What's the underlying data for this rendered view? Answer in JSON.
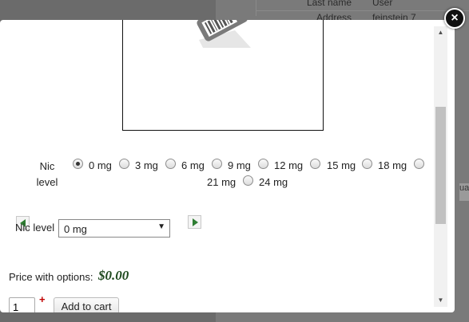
{
  "background": {
    "rows": [
      {
        "key": "Last name",
        "value": "User"
      },
      {
        "key": "Address",
        "value": "feinstein 7"
      }
    ],
    "edge_text": "ua"
  },
  "modal": {
    "close_glyph": "×",
    "product_image_icon": "barcode-price-tag-icon",
    "nic_level": {
      "label_line1": "Nic",
      "label_line2": "level",
      "options": [
        "0 mg",
        "3 mg",
        "6 mg",
        "9 mg",
        "12 mg",
        "15 mg",
        "18 mg",
        "21 mg",
        "24 mg"
      ],
      "selected": "0 mg"
    },
    "nic_level_select": {
      "label": "Nic level",
      "value": "0 mg"
    },
    "price": {
      "label": "Price with options:",
      "value": "$0.00"
    },
    "cart": {
      "quantity": "1",
      "required_marker": "+",
      "add_label": "Add to cart"
    },
    "colors": {
      "price": "#1f4a1f",
      "nav_arrow": "#2e7d32",
      "required": "#c00000"
    }
  }
}
